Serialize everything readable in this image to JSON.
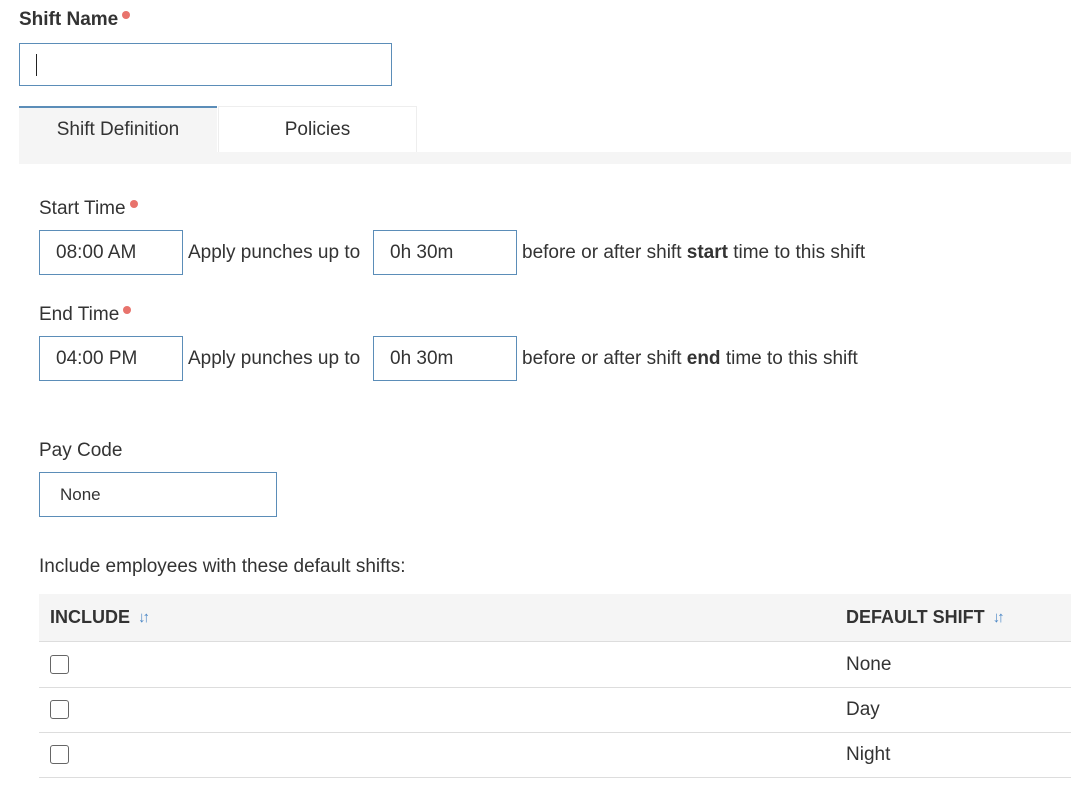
{
  "shift_name": {
    "label": "Shift Name",
    "value": ""
  },
  "tabs": [
    {
      "label": "Shift Definition",
      "active": true
    },
    {
      "label": "Policies",
      "active": false
    }
  ],
  "start_time": {
    "label": "Start Time",
    "value": "08:00 AM",
    "apply_prefix": "Apply punches up to",
    "window": "0h 30m",
    "suffix_before": "before or after shift",
    "suffix_bold": "start",
    "suffix_after": "time to this shift"
  },
  "end_time": {
    "label": "End Time",
    "value": "04:00 PM",
    "apply_prefix": "Apply punches up to",
    "window": "0h 30m",
    "suffix_before": "before or after shift",
    "suffix_bold": "end",
    "suffix_after": "time to this shift"
  },
  "pay_code": {
    "label": "Pay Code",
    "value": "None"
  },
  "default_shifts": {
    "caption": "Include employees with these default shifts:",
    "columns": [
      "INCLUDE",
      "DEFAULT SHIFT"
    ],
    "rows": [
      {
        "include": false,
        "shift": "None"
      },
      {
        "include": false,
        "shift": "Day"
      },
      {
        "include": false,
        "shift": "Night"
      }
    ]
  },
  "colors": {
    "accent": "#5b8db8",
    "required": "#e8736c",
    "sort_icon": "#4a86c5",
    "header_bg": "#f5f5f5"
  },
  "icons": {
    "sort": "sort-arrows-icon",
    "required": "required-dot-icon"
  }
}
